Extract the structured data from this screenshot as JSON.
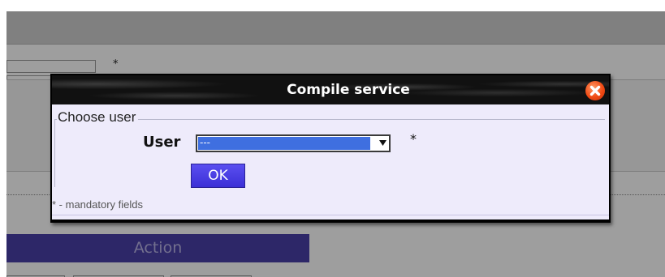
{
  "background": {
    "required_marker": "*",
    "action_header": "Action"
  },
  "dialog": {
    "title": "Compile service",
    "legend": "Choose user",
    "user_label": "User",
    "user_select": {
      "selected_value": "---"
    },
    "required_marker": "*",
    "ok_label": "OK",
    "footer_note": "* - mandatory fields"
  },
  "colors": {
    "ok_button": "#4a3fe6",
    "select_highlight": "#3f6fe0",
    "close_button": "#f04a14",
    "dialog_background": "#eeebfb",
    "titlebar": "#111111"
  },
  "icons": {
    "close": "close-circle-icon",
    "dropdown": "triangle-down-icon"
  }
}
